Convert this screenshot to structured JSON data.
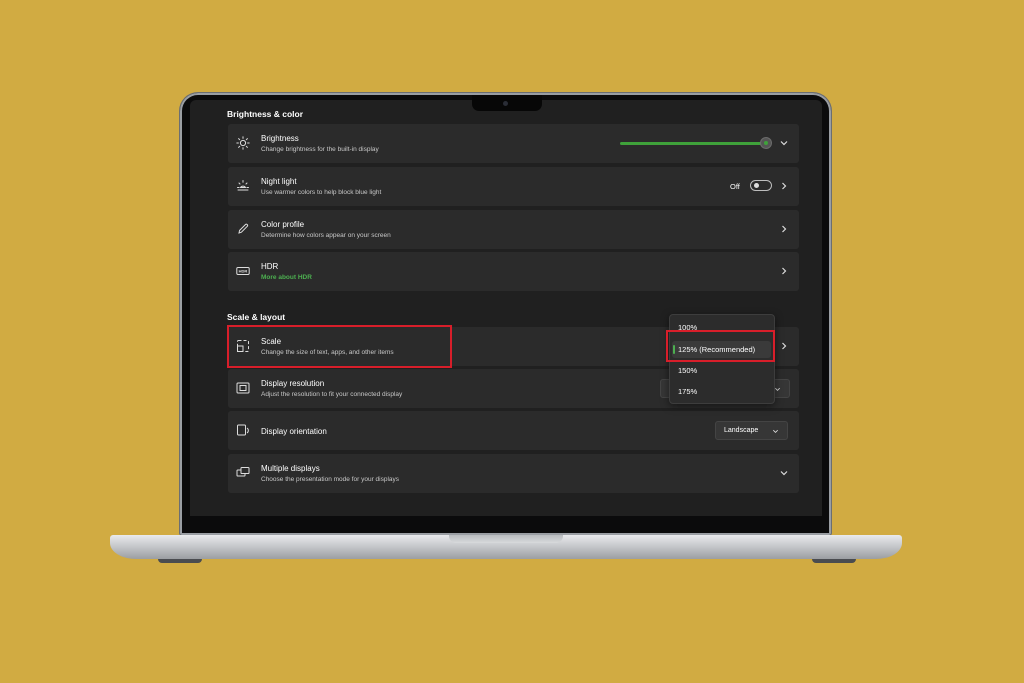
{
  "sections": {
    "brightness_color": "Brightness & color",
    "scale_layout": "Scale & layout"
  },
  "brightness": {
    "title": "Brightness",
    "subtitle": "Change brightness for the built-in display",
    "level_fraction": 1.0
  },
  "night_light": {
    "title": "Night light",
    "subtitle": "Use warmer colors to help block blue light",
    "state": "Off"
  },
  "color_profile": {
    "title": "Color profile",
    "subtitle": "Determine how colors appear on your screen"
  },
  "hdr": {
    "title": "HDR",
    "link": "More about HDR"
  },
  "scale": {
    "title": "Scale",
    "subtitle": "Change the size of text, apps, and other items",
    "options": [
      "100%",
      "125% (Recommended)",
      "150%",
      "175%"
    ],
    "selected": "125% (Recommended)"
  },
  "display_resolution": {
    "title": "Display resolution",
    "subtitle": "Adjust the resolution to fit your connected display"
  },
  "display_orientation": {
    "title": "Display orientation",
    "value": "Landscape"
  },
  "multiple_displays": {
    "title": "Multiple displays",
    "subtitle": "Choose the presentation mode for your displays"
  },
  "colors": {
    "background": "#d1ab42",
    "accent": "#3fa23a",
    "highlight": "#d81e2a",
    "card": "#2b2b2b"
  }
}
